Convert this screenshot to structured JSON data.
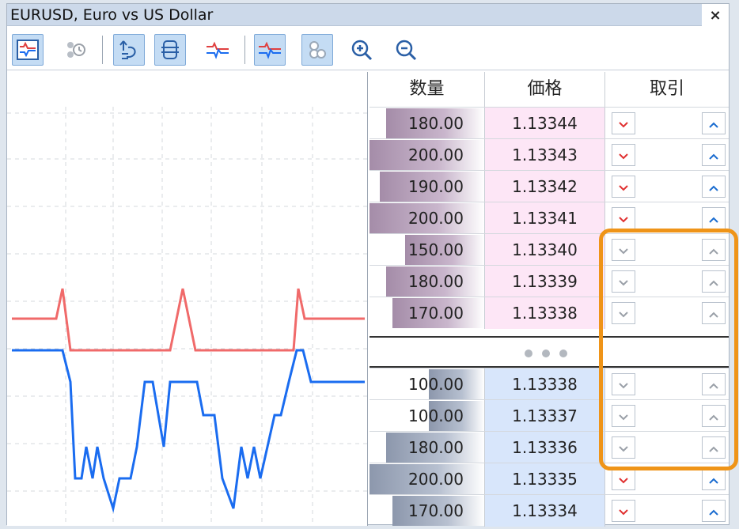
{
  "window": {
    "title": "EURUSD, Euro vs US Dollar",
    "close_glyph": "×"
  },
  "toolbar": {
    "buttons": [
      {
        "name": "chart-icon",
        "active": true
      },
      {
        "name": "one-click-trading-icon",
        "active": false
      },
      {
        "name": "auto-scroll-icon",
        "active": true
      },
      {
        "name": "center-icon",
        "active": true
      },
      {
        "name": "tick-chart-icon",
        "active": false
      },
      {
        "name": "depth-chart-icon",
        "active": true
      },
      {
        "name": "grouping-icon",
        "active": true
      },
      {
        "name": "zoom-in-icon",
        "active": false
      },
      {
        "name": "zoom-out-icon",
        "active": false
      }
    ]
  },
  "table": {
    "headers": {
      "volume": "数量",
      "price": "価格",
      "trade": "取引"
    },
    "ask_rows": [
      {
        "volume": "180.00",
        "price": "1.13344",
        "buttons_active": true
      },
      {
        "volume": "200.00",
        "price": "1.13343",
        "buttons_active": true
      },
      {
        "volume": "190.00",
        "price": "1.13342",
        "buttons_active": true
      },
      {
        "volume": "200.00",
        "price": "1.13341",
        "buttons_active": true
      },
      {
        "volume": "150.00",
        "price": "1.13340",
        "buttons_active": false
      },
      {
        "volume": "180.00",
        "price": "1.13339",
        "buttons_active": false
      },
      {
        "volume": "170.00",
        "price": "1.13338",
        "buttons_active": false
      }
    ],
    "bid_rows": [
      {
        "volume": "100.00",
        "price": "1.13338",
        "buttons_active": false
      },
      {
        "volume": "100.00",
        "price": "1.13337",
        "buttons_active": false
      },
      {
        "volume": "180.00",
        "price": "1.13336",
        "buttons_active": false
      },
      {
        "volume": "200.00",
        "price": "1.13335",
        "buttons_active": true
      },
      {
        "volume": "170.00",
        "price": "1.13334",
        "buttons_active": true
      }
    ]
  },
  "colors": {
    "ask_line": "#f06a6a",
    "bid_line": "#1a6cf0",
    "ask_price_bg": "#fde6f6",
    "bid_price_bg": "#d8e6fb",
    "sell_arrow": "#e03030",
    "buy_arrow": "#1a6cd0",
    "disabled_arrow": "#9aa0a8",
    "highlight": "#ef9418"
  }
}
